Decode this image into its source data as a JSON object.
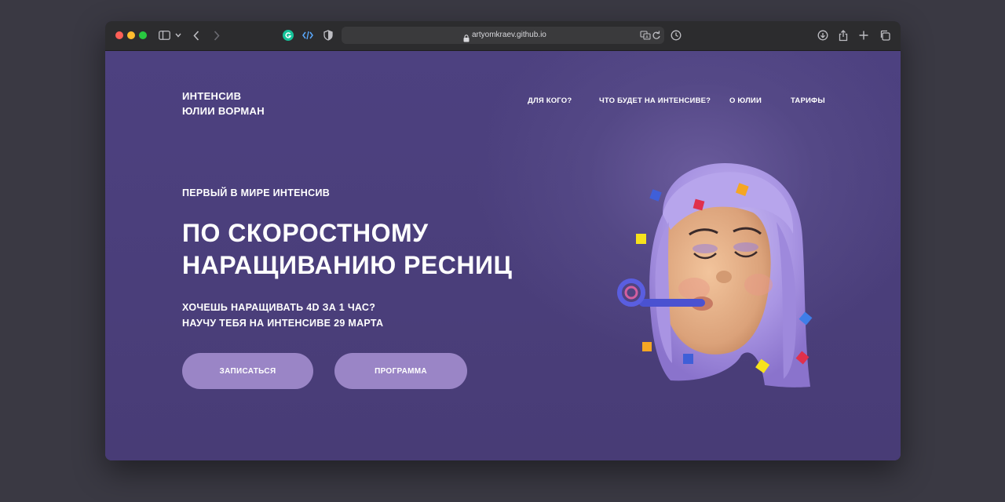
{
  "browser": {
    "url": "artyomkraev.github.io",
    "icons": [
      "sidebar-icon",
      "chevron-down-icon",
      "back-icon",
      "forward-icon",
      "grammarly-icon",
      "code-icon",
      "shield-icon",
      "lock-icon",
      "translate-icon",
      "reload-icon",
      "clock-icon",
      "download-icon",
      "share-icon",
      "new-tab-icon",
      "tabs-icon"
    ]
  },
  "site": {
    "logo": {
      "line1": "ИНТЕНСИВ",
      "line2": "ЮЛИИ ВОРМАН"
    },
    "nav": [
      {
        "label": "ДЛЯ КОГО?"
      },
      {
        "label": "ЧТО БУДЕТ НА ИНТЕНСИВЕ?"
      },
      {
        "label": "О ЮЛИИ"
      },
      {
        "label": "ТАРИФЫ"
      }
    ],
    "hero": {
      "eyebrow": "ПЕРВЫЙ В МИРЕ ИНТЕНСИВ",
      "title_line1": "ПО СКОРОСТНОМУ",
      "title_line2": "НАРАЩИВАНИЮ РЕСНИЦ",
      "sub_line1": "ХОЧЕШЬ НАРАЩИВАТЬ 4D ЗА 1 ЧАС?",
      "sub_line2": "НАУЧУ ТЕБЯ НА ИНТЕНСИВЕ 29 МАРТА",
      "primary_button": "ЗАПИСАТЬСЯ",
      "secondary_button": "ПРОГРАММА"
    }
  },
  "colors": {
    "page_bg": "#4b3f78",
    "button": "#9a85c6",
    "hair": "#b9a8ec",
    "skin": "#e8b58c"
  }
}
